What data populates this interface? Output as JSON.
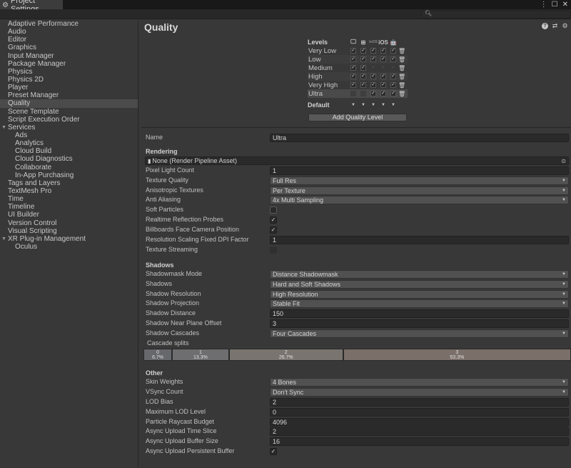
{
  "window": {
    "tab_title": "Project Settings",
    "controls": [
      "more-icon",
      "maximize-icon",
      "close-icon"
    ]
  },
  "search": {
    "placeholder": "",
    "value": ""
  },
  "sidebar": {
    "items": [
      {
        "label": "Adaptive Performance",
        "level": 0
      },
      {
        "label": "Audio",
        "level": 0
      },
      {
        "label": "Editor",
        "level": 0
      },
      {
        "label": "Graphics",
        "level": 0
      },
      {
        "label": "Input Manager",
        "level": 0
      },
      {
        "label": "Package Manager",
        "level": 0
      },
      {
        "label": "Physics",
        "level": 0
      },
      {
        "label": "Physics 2D",
        "level": 0
      },
      {
        "label": "Player",
        "level": 0
      },
      {
        "label": "Preset Manager",
        "level": 0
      },
      {
        "label": "Quality",
        "level": 0,
        "selected": true
      },
      {
        "label": "Scene Template",
        "level": 0
      },
      {
        "label": "Script Execution Order",
        "level": 0
      },
      {
        "label": "Services",
        "level": 0,
        "expanded": true
      },
      {
        "label": "Ads",
        "level": 1
      },
      {
        "label": "Analytics",
        "level": 1
      },
      {
        "label": "Cloud Build",
        "level": 1
      },
      {
        "label": "Cloud Diagnostics",
        "level": 1
      },
      {
        "label": "Collaborate",
        "level": 1
      },
      {
        "label": "In-App Purchasing",
        "level": 1
      },
      {
        "label": "Tags and Layers",
        "level": 0
      },
      {
        "label": "TextMesh Pro",
        "level": 0
      },
      {
        "label": "Time",
        "level": 0
      },
      {
        "label": "Timeline",
        "level": 0
      },
      {
        "label": "UI Builder",
        "level": 0
      },
      {
        "label": "Version Control",
        "level": 0
      },
      {
        "label": "Visual Scripting",
        "level": 0
      },
      {
        "label": "XR Plug-in Management",
        "level": 0,
        "expanded": true
      },
      {
        "label": "Oculus",
        "level": 1
      }
    ]
  },
  "main": {
    "title": "Quality",
    "header_icons": [
      "help-icon",
      "presets-icon",
      "settings-gear-icon"
    ],
    "levels": {
      "heading": "Levels",
      "platforms": [
        {
          "name": "Standalone",
          "icon": "monitor-icon",
          "glyph": "🖵"
        },
        {
          "name": "Windows Store",
          "icon": "windows-icon",
          "glyph": "⊞"
        },
        {
          "name": "tvOS",
          "icon": "tvos-icon",
          "glyph": "tvOS"
        },
        {
          "name": "iOS",
          "icon": "ios-icon",
          "glyph": "iOS"
        },
        {
          "name": "Android",
          "icon": "android-icon",
          "glyph": "🤖"
        }
      ],
      "rows": [
        {
          "name": "Very Low",
          "checks": [
            true,
            true,
            true,
            true,
            true
          ]
        },
        {
          "name": "Low",
          "checks": [
            true,
            true,
            true,
            true,
            true
          ]
        },
        {
          "name": "Medium",
          "checks": [
            true,
            true,
            false,
            false,
            false
          ]
        },
        {
          "name": "High",
          "checks": [
            true,
            true,
            true,
            true,
            true
          ]
        },
        {
          "name": "Very High",
          "checks": [
            true,
            true,
            true,
            true,
            true
          ]
        },
        {
          "name": "Ultra",
          "checks": [
            null,
            null,
            true,
            true,
            true
          ],
          "selected": true
        }
      ],
      "default_label": "Default",
      "add_button": "Add Quality Level"
    },
    "name_row": {
      "label": "Name",
      "value": "Ultra"
    },
    "rendering": {
      "heading": "Rendering",
      "pipeline_asset": "None (Render Pipeline Asset)",
      "rows": [
        {
          "label": "Pixel Light Count",
          "type": "text",
          "value": "1"
        },
        {
          "label": "Texture Quality",
          "type": "dropdown",
          "value": "Full Res"
        },
        {
          "label": "Anisotropic Textures",
          "type": "dropdown",
          "value": "Per Texture"
        },
        {
          "label": "Anti Aliasing",
          "type": "dropdown",
          "value": "4x Multi Sampling"
        },
        {
          "label": "Soft Particles",
          "type": "checkbox",
          "checked": false
        },
        {
          "label": "Realtime Reflection Probes",
          "type": "checkbox",
          "checked": true
        },
        {
          "label": "Billboards Face Camera Position",
          "type": "checkbox",
          "checked": true
        },
        {
          "label": "Resolution Scaling Fixed DPI Factor",
          "type": "text",
          "value": "1"
        },
        {
          "label": "Texture Streaming",
          "type": "checkbox",
          "checked": false,
          "disabled": true
        }
      ]
    },
    "shadows": {
      "heading": "Shadows",
      "rows": [
        {
          "label": "Shadowmask Mode",
          "type": "dropdown",
          "value": "Distance Shadowmask"
        },
        {
          "label": "Shadows",
          "type": "dropdown",
          "value": "Hard and Soft Shadows"
        },
        {
          "label": "Shadow Resolution",
          "type": "dropdown",
          "value": "High Resolution"
        },
        {
          "label": "Shadow Projection",
          "type": "dropdown",
          "value": "Stable Fit"
        },
        {
          "label": "Shadow Distance",
          "type": "text",
          "value": "150"
        },
        {
          "label": "Shadow Near Plane Offset",
          "type": "text",
          "value": "3"
        },
        {
          "label": "Shadow Cascades",
          "type": "dropdown",
          "value": "Four Cascades"
        }
      ],
      "cascade_label": "Cascade splits",
      "cascades": [
        {
          "index": "0",
          "percent": "6.7%",
          "fraction": 0.067
        },
        {
          "index": "1",
          "percent": "13.3%",
          "fraction": 0.133
        },
        {
          "index": "2",
          "percent": "26.7%",
          "fraction": 0.267
        },
        {
          "index": "3",
          "percent": "53.3%",
          "fraction": 0.533
        }
      ]
    },
    "other": {
      "heading": "Other",
      "rows": [
        {
          "label": "Skin Weights",
          "type": "dropdown",
          "value": "4 Bones"
        },
        {
          "label": "VSync Count",
          "type": "dropdown",
          "value": "Don't Sync"
        },
        {
          "label": "LOD Bias",
          "type": "text",
          "value": "2"
        },
        {
          "label": "Maximum LOD Level",
          "type": "text",
          "value": "0"
        },
        {
          "label": "Particle Raycast Budget",
          "type": "text",
          "value": "4096"
        },
        {
          "label": "Async Upload Time Slice",
          "type": "text",
          "value": "2"
        },
        {
          "label": "Async Upload Buffer Size",
          "type": "text",
          "value": "16"
        },
        {
          "label": "Async Upload Persistent Buffer",
          "type": "checkbox",
          "checked": true
        }
      ]
    }
  }
}
